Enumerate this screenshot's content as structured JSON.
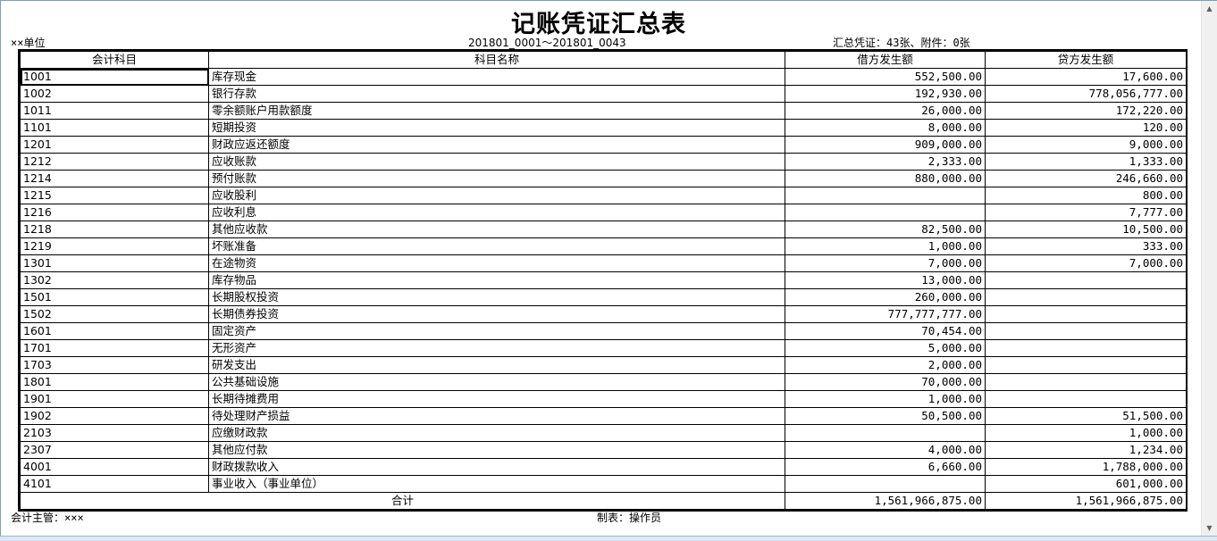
{
  "report": {
    "title": "记账凭证汇总表",
    "unit": "××单位",
    "range": "201801_0001～201801_0043",
    "summary": "汇总凭证：43张、附件：0张",
    "columns": [
      "会计科目",
      "科目名称",
      "借方发生额",
      "贷方发生额"
    ],
    "rows": [
      {
        "code": "1001",
        "name": "库存现金",
        "debit": "552,500.00",
        "credit": "17,600.00"
      },
      {
        "code": "1002",
        "name": "银行存款",
        "debit": "192,930.00",
        "credit": "778,056,777.00"
      },
      {
        "code": "1011",
        "name": "零余额账户用款额度",
        "debit": "26,000.00",
        "credit": "172,220.00"
      },
      {
        "code": "1101",
        "name": "短期投资",
        "debit": "8,000.00",
        "credit": "120.00"
      },
      {
        "code": "1201",
        "name": "财政应返还额度",
        "debit": "909,000.00",
        "credit": "9,000.00"
      },
      {
        "code": "1212",
        "name": "应收账款",
        "debit": "2,333.00",
        "credit": "1,333.00"
      },
      {
        "code": "1214",
        "name": "预付账款",
        "debit": "880,000.00",
        "credit": "246,660.00"
      },
      {
        "code": "1215",
        "name": "应收股利",
        "debit": "",
        "credit": "800.00"
      },
      {
        "code": "1216",
        "name": "应收利息",
        "debit": "",
        "credit": "7,777.00"
      },
      {
        "code": "1218",
        "name": "其他应收款",
        "debit": "82,500.00",
        "credit": "10,500.00"
      },
      {
        "code": "1219",
        "name": "坏账准备",
        "debit": "1,000.00",
        "credit": "333.00"
      },
      {
        "code": "1301",
        "name": "在途物资",
        "debit": "7,000.00",
        "credit": "7,000.00"
      },
      {
        "code": "1302",
        "name": "库存物品",
        "debit": "13,000.00",
        "credit": ""
      },
      {
        "code": "1501",
        "name": "长期股权投资",
        "debit": "260,000.00",
        "credit": ""
      },
      {
        "code": "1502",
        "name": "长期债券投资",
        "debit": "777,777,777.00",
        "credit": ""
      },
      {
        "code": "1601",
        "name": "固定资产",
        "debit": "70,454.00",
        "credit": ""
      },
      {
        "code": "1701",
        "name": "无形资产",
        "debit": "5,000.00",
        "credit": ""
      },
      {
        "code": "1703",
        "name": "研发支出",
        "debit": "2,000.00",
        "credit": ""
      },
      {
        "code": "1801",
        "name": "公共基础设施",
        "debit": "70,000.00",
        "credit": ""
      },
      {
        "code": "1901",
        "name": "长期待摊费用",
        "debit": "1,000.00",
        "credit": ""
      },
      {
        "code": "1902",
        "name": "待处理财产损益",
        "debit": "50,500.00",
        "credit": "51,500.00"
      },
      {
        "code": "2103",
        "name": "应缴财政款",
        "debit": "",
        "credit": "1,000.00"
      },
      {
        "code": "2307",
        "name": "其他应付款",
        "debit": "4,000.00",
        "credit": "1,234.00"
      },
      {
        "code": "4001",
        "name": "财政拨款收入",
        "debit": "6,660.00",
        "credit": "1,788,000.00"
      },
      {
        "code": "4101",
        "name": "事业收入（事业单位）",
        "debit": "",
        "credit": "601,000.00"
      }
    ],
    "total": {
      "label": "合计",
      "debit": "1,561,966,875.00",
      "credit": "1,561,966,875.00"
    },
    "supervisor": "会计主管：×××",
    "preparer": "制表：操作员"
  },
  "icons": {
    "scroll_up": "scroll-up-arrow-icon",
    "scroll_down": "scroll-down-arrow-icon"
  }
}
